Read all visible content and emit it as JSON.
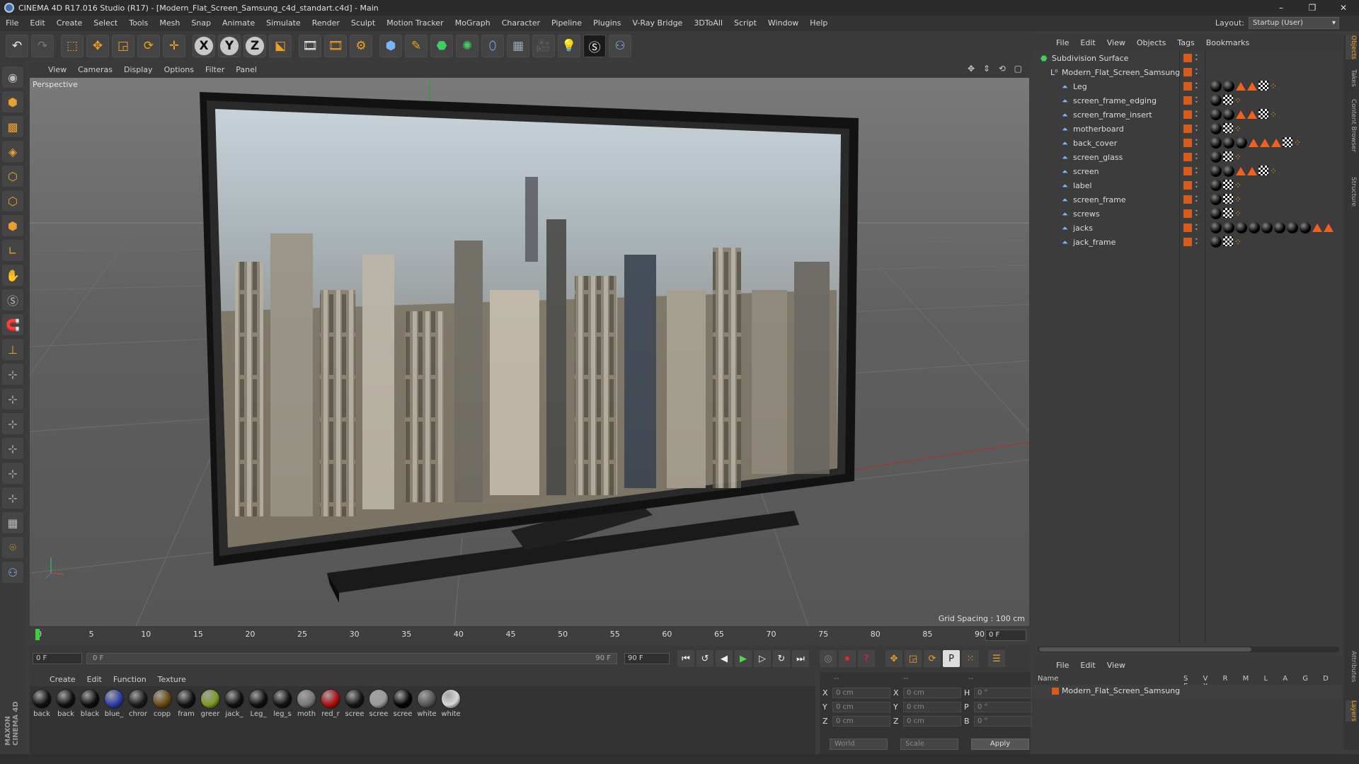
{
  "window": {
    "title": "CINEMA 4D R17.016 Studio (R17) - [Modern_Flat_Screen_Samsung_c4d_standart.c4d] - Main",
    "controls": [
      "–",
      "❐",
      "✕"
    ]
  },
  "menubar": {
    "items": [
      "File",
      "Edit",
      "Create",
      "Select",
      "Tools",
      "Mesh",
      "Snap",
      "Animate",
      "Simulate",
      "Render",
      "Sculpt",
      "Motion Tracker",
      "MoGraph",
      "Character",
      "Pipeline",
      "Plugins",
      "V-Ray Bridge",
      "3DToAll",
      "Script",
      "Window",
      "Help"
    ],
    "layout_label": "Layout:",
    "layout_value": "Startup (User)"
  },
  "toolbar": {
    "icons": [
      "undo-icon",
      "redo-icon",
      "select-icon",
      "move-icon",
      "scale-icon",
      "rotate-icon",
      "transform-icon",
      "x-axis-icon",
      "y-axis-icon",
      "z-axis-icon",
      "coord-system-icon",
      "render-view-icon",
      "render-picture-viewer-icon",
      "edit-render-settings-icon",
      "cube-icon",
      "pen-icon",
      "subdivision-icon",
      "array-icon",
      "deformer-icon",
      "floor-icon",
      "camera-icon",
      "light-icon",
      "vray-icon",
      "python-icon"
    ],
    "axis_labels": [
      "X",
      "Y",
      "Z"
    ]
  },
  "viewport": {
    "menu": [
      "View",
      "Cameras",
      "Display",
      "Options",
      "Filter",
      "Panel"
    ],
    "label": "Perspective",
    "grid_spacing": "Grid Spacing : 100 cm",
    "nav_icons": "✥ ⇕ ⟲ ▢"
  },
  "timeline": {
    "ticks": [
      "0",
      "5",
      "10",
      "15",
      "20",
      "25",
      "30",
      "35",
      "40",
      "45",
      "50",
      "55",
      "60",
      "65",
      "70",
      "75",
      "80",
      "85",
      "90"
    ],
    "current_frame": "0 F"
  },
  "transport": {
    "start_field": "0 F",
    "range_start": "0 F",
    "range_end": "90 F",
    "end_field": "90 F"
  },
  "materials": {
    "menu": [
      "Create",
      "Edit",
      "Function",
      "Texture"
    ],
    "items": [
      {
        "label": "back",
        "color": "#111111"
      },
      {
        "label": "back",
        "color": "#111111"
      },
      {
        "label": "black",
        "color": "#0d0d0d"
      },
      {
        "label": "blue_",
        "color": "#2a3fa8"
      },
      {
        "label": "chror",
        "color": "#1a1a1a"
      },
      {
        "label": "copp",
        "color": "#6b4a10"
      },
      {
        "label": "fram",
        "color": "#111111"
      },
      {
        "label": "greer",
        "color": "#7a9a20"
      },
      {
        "label": "jack_",
        "color": "#111111"
      },
      {
        "label": "Leg_",
        "color": "#111111"
      },
      {
        "label": "leg_s",
        "color": "#111111"
      },
      {
        "label": "moth",
        "color": "#777777"
      },
      {
        "label": "red_r",
        "color": "#b01010"
      },
      {
        "label": "scree",
        "color": "#151515"
      },
      {
        "label": "scree",
        "color": "#9a9a9a"
      },
      {
        "label": "scree",
        "color": "#050505"
      },
      {
        "label": "white",
        "color": "#555555"
      },
      {
        "label": "white",
        "color": "#d8d8d8"
      }
    ]
  },
  "coordinates": {
    "header": [
      "--",
      "--",
      "--"
    ],
    "rows": [
      {
        "a": "X",
        "a_val": "0 cm",
        "b": "X",
        "b_val": "0 cm",
        "c": "H",
        "c_val": "0 °"
      },
      {
        "a": "Y",
        "a_val": "0 cm",
        "b": "Y",
        "b_val": "0 cm",
        "c": "P",
        "c_val": "0 °"
      },
      {
        "a": "Z",
        "a_val": "0 cm",
        "b": "Z",
        "b_val": "0 cm",
        "c": "B",
        "c_val": "0 °"
      }
    ],
    "world": "World",
    "scale": "Scale",
    "apply": "Apply"
  },
  "object_manager": {
    "menu": [
      "File",
      "Edit",
      "View",
      "Objects",
      "Tags",
      "Bookmarks"
    ],
    "root": "Subdivision Surface",
    "group": "Modern_Flat_Screen_Samsung",
    "children": [
      {
        "name": "Leg",
        "tags": [
          "mat",
          "mat",
          "tri",
          "tri",
          "chk",
          "dots"
        ]
      },
      {
        "name": "screen_frame_edging",
        "tags": [
          "mat",
          "chk",
          "dots"
        ]
      },
      {
        "name": "screen_frame_insert",
        "tags": [
          "mat",
          "mat",
          "tri",
          "tri",
          "chk",
          "dots"
        ]
      },
      {
        "name": "motherboard",
        "tags": [
          "mat",
          "chk",
          "dots"
        ]
      },
      {
        "name": "back_cover",
        "tags": [
          "mat",
          "mat",
          "mat",
          "tri",
          "tri",
          "tri",
          "chk",
          "dots"
        ]
      },
      {
        "name": "screen_glass",
        "tags": [
          "mat",
          "chk",
          "dots"
        ]
      },
      {
        "name": "screen",
        "tags": [
          "mat",
          "mat",
          "tri",
          "tri",
          "chk",
          "dots"
        ]
      },
      {
        "name": "label",
        "tags": [
          "mat",
          "chk",
          "dots"
        ]
      },
      {
        "name": "screen_frame",
        "tags": [
          "mat",
          "chk",
          "dots"
        ]
      },
      {
        "name": "screws",
        "tags": [
          "mat",
          "chk",
          "dots"
        ]
      },
      {
        "name": "jacks",
        "tags": [
          "mat",
          "mat",
          "mat",
          "mat",
          "mat",
          "mat",
          "mat",
          "mat",
          "tri",
          "tri"
        ]
      },
      {
        "name": "jack_frame",
        "tags": [
          "mat",
          "chk",
          "dots"
        ]
      }
    ]
  },
  "layer_manager": {
    "menu": [
      "File",
      "Edit",
      "View"
    ],
    "name_header": "Name",
    "columns": "S V R M L A G D E X",
    "row_name": "Modern_Flat_Screen_Samsung"
  },
  "edge_tabs": [
    "Objects",
    "Takes",
    "Content Browser",
    "Structure",
    "Attributes",
    "Layers"
  ],
  "maxon_logo": "MAXON CINEMA 4D"
}
